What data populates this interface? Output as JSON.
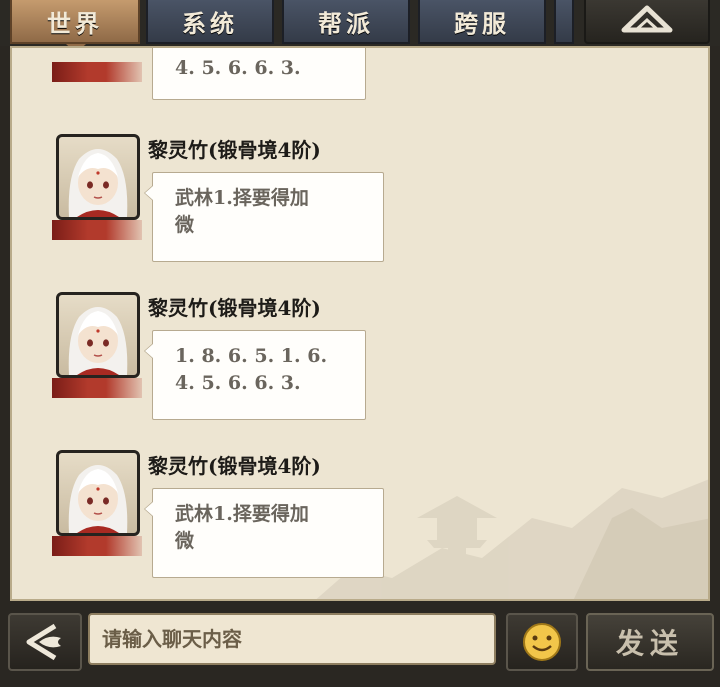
{
  "tabs": [
    {
      "label": "世界",
      "active": true
    },
    {
      "label": "系统",
      "active": false
    },
    {
      "label": "帮派",
      "active": false
    },
    {
      "label": "跨服",
      "active": false
    }
  ],
  "collapse_icon": "chevron-up-icon",
  "messages": [
    {
      "sender": "",
      "title": "",
      "lines": [
        "4. 5. 6. 6. 3."
      ]
    },
    {
      "sender": "黎灵竹(锻骨境4阶)",
      "title": "",
      "lines": [
        "武林1.择要得加",
        "微"
      ]
    },
    {
      "sender": "黎灵竹(锻骨境4阶)",
      "title": "",
      "lines": [
        "1. 8. 6. 5. 1. 6.",
        "4. 5. 6. 6. 3."
      ]
    },
    {
      "sender": "黎灵竹(锻骨境4阶)",
      "title": "",
      "lines": [
        "武林1.择要得加",
        "微"
      ]
    }
  ],
  "input": {
    "placeholder": "请输入聊天内容",
    "value": ""
  },
  "send_label": "发送",
  "icons": {
    "back": "back-arrow-icon",
    "emoji": "smiley-icon"
  },
  "colors": {
    "accent": "#c59b6e",
    "panel": "#ede5d2",
    "tab": "#4a5466"
  }
}
